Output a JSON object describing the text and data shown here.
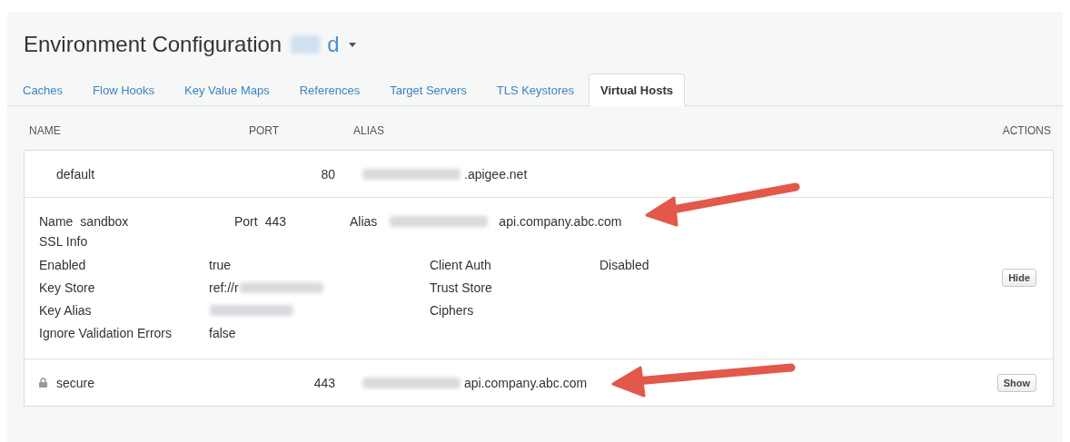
{
  "header": {
    "title": "Environment Configuration",
    "environment": "d",
    "environment_redacted": true
  },
  "tabs": [
    {
      "label": "Caches",
      "selected": false
    },
    {
      "label": "Flow Hooks",
      "selected": false
    },
    {
      "label": "Key Value Maps",
      "selected": false
    },
    {
      "label": "References",
      "selected": false
    },
    {
      "label": "Target Servers",
      "selected": false
    },
    {
      "label": "TLS Keystores",
      "selected": false
    },
    {
      "label": "Virtual Hosts",
      "selected": true
    }
  ],
  "columns": [
    "NAME",
    "PORT",
    "ALIAS",
    "ACTIONS"
  ],
  "hosts": [
    {
      "kind": "summary",
      "name": "default",
      "locked": false,
      "port": "80",
      "alias": ".apigee.net",
      "alias_redacted": true
    },
    {
      "kind": "expanded",
      "name_label": "Name",
      "name": "sandbox",
      "port_label": "Port",
      "port": "443",
      "alias_label": "Alias",
      "alias": "api.company.abc.com",
      "alias_redacted": true,
      "section": "SSL Info",
      "action": "Hide",
      "fields": [
        {
          "label": "Enabled",
          "value": "true",
          "value_redacted": false,
          "label2": "Client Auth",
          "value2": "Disabled"
        },
        {
          "label": "Key Store",
          "value": "ref://r",
          "value_redacted": true,
          "label2": "Trust Store"
        },
        {
          "label": "Key Alias",
          "value_redacted": true,
          "label2": "Ciphers"
        },
        {
          "label": "Ignore Validation Errors",
          "value": "false",
          "value_redacted": false
        }
      ]
    },
    {
      "kind": "summary",
      "name": "secure",
      "locked": true,
      "port": "443",
      "alias": "api.company.abc.com",
      "alias_redacted": true,
      "action": "Show"
    }
  ]
}
